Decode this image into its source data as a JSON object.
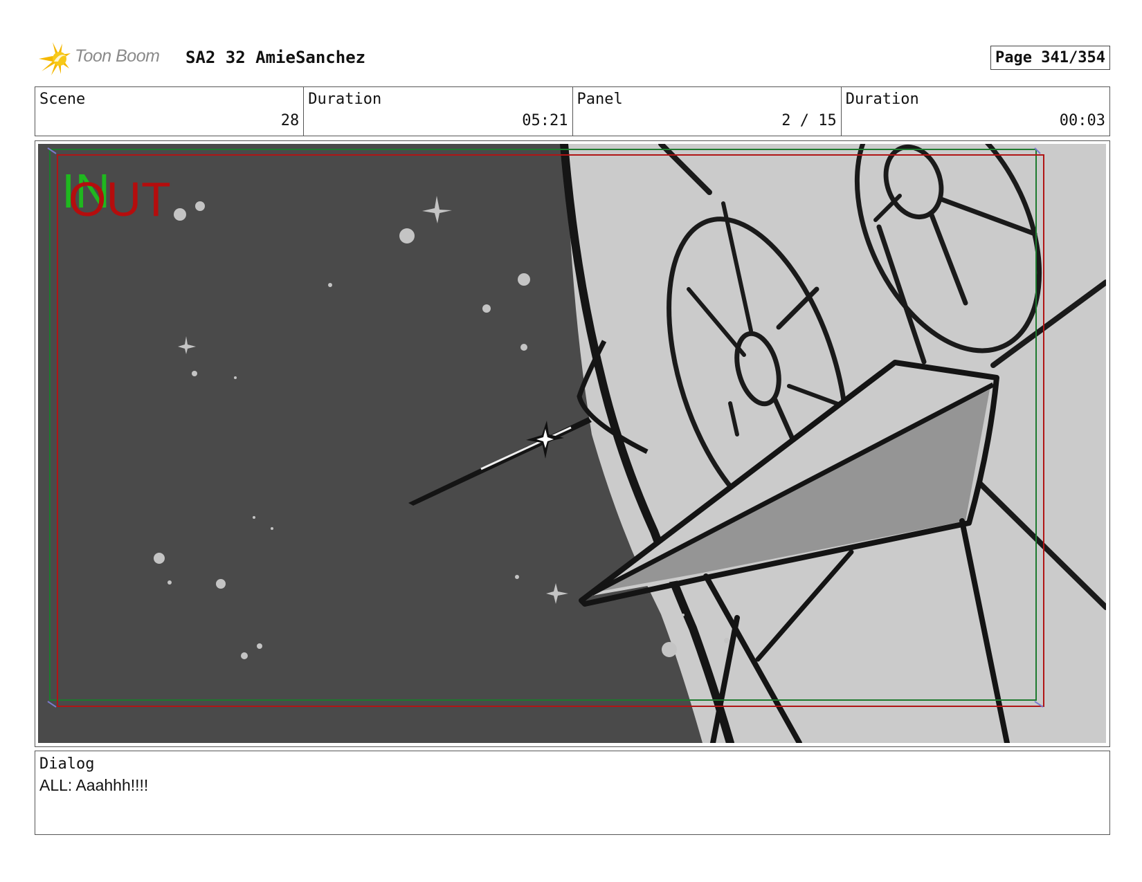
{
  "header": {
    "logo_text": "Toon Boom",
    "project_title": "SA2 32 AmieSanchez",
    "page": "Page 341/354"
  },
  "info": {
    "scene_label": "Scene",
    "scene_value": "28",
    "duration_label": "Duration",
    "duration_value": "05:21",
    "panel_label": "Panel",
    "panel_value": "2 / 15",
    "panel_duration_label": "Duration",
    "panel_duration_value": "00:03"
  },
  "panel": {
    "in_marker": "IN",
    "out_marker": "OUT",
    "colors": {
      "space": "#4a4a4a",
      "ship_hull": "#cbcbcb",
      "ship_wing_shade": "#959595",
      "star": "#c4c4c4",
      "safe_frame": "#1d7a2e",
      "camera_frame": "#b01515",
      "in_marker": "#1fb81f",
      "out_marker": "#b50d0d"
    }
  },
  "dialog": {
    "label": "Dialog",
    "text": "ALL: Aaahhh!!!!"
  }
}
